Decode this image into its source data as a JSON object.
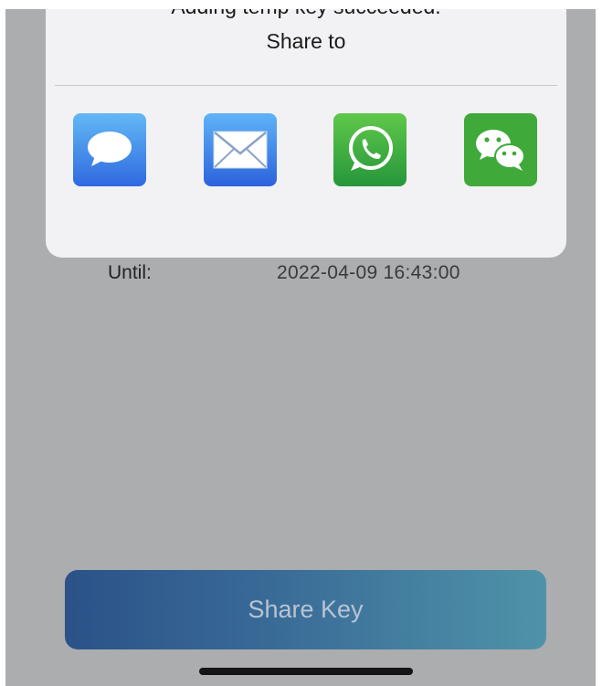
{
  "share_sheet": {
    "title": "Adding temp key succeeded.",
    "subtitle": "Share to",
    "apps": [
      {
        "name": "Messages",
        "icon": "speech-bubble-icon"
      },
      {
        "name": "Mail",
        "icon": "envelope-icon"
      },
      {
        "name": "WhatsApp",
        "icon": "whatsapp-phone-icon"
      },
      {
        "name": "WeChat",
        "icon": "wechat-bubbles-icon"
      }
    ]
  },
  "key_details": {
    "until_label": "Until:",
    "until_value": "2022-04-09 16:43:00"
  },
  "actions": {
    "share_key_label": "Share Key"
  },
  "colors": {
    "backdrop": "#acadaf",
    "sheet": "#f2f2f4",
    "button_gradient_start": "#2b5288",
    "button_gradient_end": "#4f93a8",
    "whatsapp_green": "#3eb84a",
    "wechat_green": "#3fa93a",
    "messages_blue": "#2f6ae0"
  }
}
